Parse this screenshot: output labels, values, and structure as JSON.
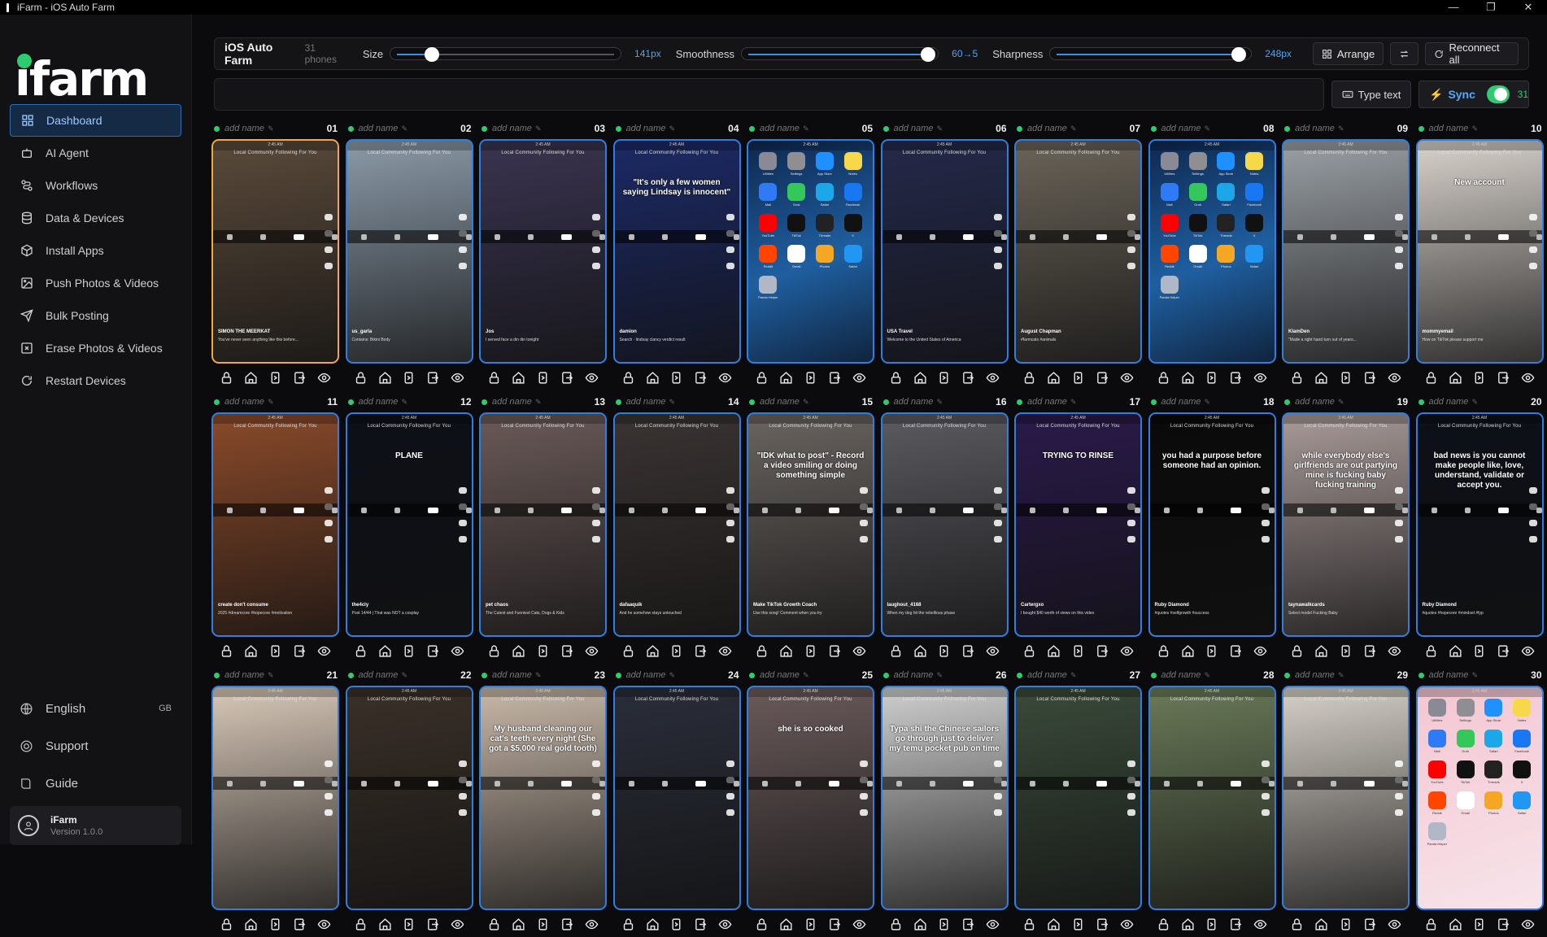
{
  "window": {
    "title": "iFarm - iOS Auto Farm",
    "controls": [
      "—",
      "❐",
      "✕"
    ]
  },
  "sidebar": {
    "logo": "ifarm",
    "items": [
      {
        "label": "Dashboard",
        "icon": "grid-icon",
        "active": true
      },
      {
        "label": "AI Agent",
        "icon": "robot-icon"
      },
      {
        "label": "Workflows",
        "icon": "workflow-icon"
      },
      {
        "label": "Data & Devices",
        "icon": "database-icon"
      },
      {
        "label": "Install Apps",
        "icon": "package-icon"
      },
      {
        "label": "Push Photos & Videos",
        "icon": "image-push-icon"
      },
      {
        "label": "Bulk Posting",
        "icon": "send-icon"
      },
      {
        "label": "Erase Photos & Videos",
        "icon": "erase-icon"
      },
      {
        "label": "Restart Devices",
        "icon": "restart-icon"
      }
    ],
    "language": {
      "label": "English",
      "code": "GB"
    },
    "support": "Support",
    "guide": "Guide",
    "user": {
      "name": "iFarm",
      "version": "Version 1.0.0"
    }
  },
  "toolbar": {
    "title": "iOS Auto Farm",
    "count": "31 phones",
    "size": {
      "label": "Size",
      "value": "141px",
      "level": 0.16
    },
    "smoothness": {
      "label": "Smoothness",
      "value": "60→5",
      "level": 0.98
    },
    "sharpness": {
      "label": "Sharpness",
      "value": "248px",
      "level": 0.97
    },
    "arrange": "Arrange",
    "reconnect": "Reconnect all"
  },
  "command": {
    "type_text": "Type text",
    "sync_label": "Sync",
    "sync_on": true,
    "sync_count": "31"
  },
  "device_name_placeholder": "add name",
  "devices": [
    {
      "num": "01",
      "screen": "tiktok",
      "selected": true,
      "user": "SIMON THE MEERKAT",
      "desc": "You've never seen anything like this before..."
    },
    {
      "num": "02",
      "screen": "tiktok",
      "user": "us_garla",
      "desc": "Contains: Bikini Body"
    },
    {
      "num": "03",
      "screen": "tiktok",
      "user": "Jos",
      "desc": "I served face a din din tonight"
    },
    {
      "num": "04",
      "screen": "tiktok",
      "caption": "\"It's only a few women saying Lindsay is innocent\"",
      "user": "damion",
      "desc": "Search · lindsay clancy verdict result"
    },
    {
      "num": "05",
      "screen": "home"
    },
    {
      "num": "06",
      "screen": "tiktok",
      "user": "USA Travel",
      "desc": "Welcome to the United States of America"
    },
    {
      "num": "07",
      "screen": "tiktok",
      "user": "August Chapman",
      "desc": "#farmcats #animals"
    },
    {
      "num": "08",
      "screen": "home"
    },
    {
      "num": "09",
      "screen": "tiktok",
      "user": "KlamDen",
      "desc": "\"Made a right hand turn out of years..."
    },
    {
      "num": "10",
      "screen": "tiktok",
      "caption": "New account",
      "user": "mommyemail",
      "desc": "How on TikTok please support me"
    },
    {
      "num": "11",
      "screen": "tiktok",
      "user": "create don't consume",
      "desc": "2025 #dreamcore #hopecore #motivation"
    },
    {
      "num": "12",
      "screen": "tiktok",
      "caption": "PLANE",
      "user": "the4cly",
      "desc": "Post 14/44 | That was NOT a cosplay"
    },
    {
      "num": "13",
      "screen": "tiktok",
      "user": "pet chaos",
      "desc": "The Cutest and Funniest Cats, Dogs & Kids"
    },
    {
      "num": "14",
      "screen": "tiktok",
      "user": "dafaaquik",
      "desc": "And he somehow stays untouched"
    },
    {
      "num": "15",
      "screen": "tiktok",
      "caption": "\"IDK what to post\" - Record a video smiling or doing something simple",
      "user": "Make TikTok Growth Coach",
      "desc": "Use this song! Comment when you try"
    },
    {
      "num": "16",
      "screen": "tiktok",
      "user": "laughout_4168",
      "desc": "When my dog hit the rebellious phase"
    },
    {
      "num": "17",
      "screen": "tiktok",
      "caption": "TRYING TO RINSE",
      "user": "Cartergxo",
      "desc": "I bought $40 worth of views on this video"
    },
    {
      "num": "18",
      "screen": "tiktok",
      "caption": "you had a purpose before someone had an opinion.",
      "user": "Ruby Diamond",
      "desc": "#quotes #selfgrowth #success"
    },
    {
      "num": "19",
      "screen": "tiktok",
      "caption": "while everybody else's girlfriends are out partying mine is fucking baby fucking training",
      "user": "taynawalkcards",
      "desc": "Select model Fucking Baby"
    },
    {
      "num": "20",
      "screen": "tiktok",
      "caption": "bad news is you cannot make people like, love, understand, validate or accept you.",
      "user": "Ruby Diamond",
      "desc": "#quotes #hopecore #mindset #fyp"
    },
    {
      "num": "21",
      "screen": "tiktok",
      "user": "",
      "desc": ""
    },
    {
      "num": "22",
      "screen": "tiktok",
      "user": "",
      "desc": ""
    },
    {
      "num": "23",
      "screen": "tiktok",
      "caption": "My husband cleaning our cat's teeth every night (She got a $5,000 real gold tooth)",
      "user": "",
      "desc": ""
    },
    {
      "num": "24",
      "screen": "tiktok",
      "user": "",
      "desc": ""
    },
    {
      "num": "25",
      "screen": "tiktok",
      "caption": "she is so cooked",
      "user": "",
      "desc": ""
    },
    {
      "num": "26",
      "screen": "tiktok",
      "caption": "Typa shi the Chinese sailors go through just to deliver my temu pocket pub on time",
      "user": "",
      "desc": ""
    },
    {
      "num": "27",
      "screen": "tiktok",
      "user": "",
      "desc": ""
    },
    {
      "num": "28",
      "screen": "tiktok",
      "user": "",
      "desc": ""
    },
    {
      "num": "29",
      "screen": "tiktok",
      "user": "",
      "desc": ""
    },
    {
      "num": "30",
      "screen": "home_light"
    }
  ],
  "tiktok_ui": {
    "status": "2:45 AM",
    "tabs": "Local   Community   Following   For You"
  },
  "home_apps": [
    "Utilities",
    "Settings",
    "App Store",
    "Notes",
    "Mail",
    "Grok",
    "Safari",
    "Facebook",
    "YouTube",
    "TikTok",
    "Threads",
    "X",
    "Reddit",
    "Gmail",
    "Photos",
    "Safari",
    "Panda Helper"
  ],
  "home_colors": [
    "#8a8a96",
    "#8e8e93",
    "#1e90ff",
    "#f7d84a",
    "#2f7bf5",
    "#34c759",
    "#1ba7e8",
    "#1877f2",
    "#ff0000",
    "#111111",
    "#222222",
    "#111111",
    "#ff4500",
    "#ffffff",
    "#f5a623",
    "#2196f3",
    "#b0b8c8"
  ],
  "screen_palettes": [
    "#5a4a3a",
    "#8b9aa8",
    "#3a3450",
    "#1c2a66",
    "#1a3d66",
    "#24294a",
    "#6a6358",
    "#1a3d66",
    "#9aa0a6",
    "#d8d2cc",
    "#8a4a2a",
    "#0d1018",
    "#6a5a58",
    "#3a3432",
    "#6a6460",
    "#5a5a60",
    "#2a1a4a",
    "#0a0a0a",
    "#a89a98",
    "#0c1018",
    "#d8c8b8",
    "#3a3028",
    "#c8b8a8",
    "#2a2e3a",
    "#6a5a5a",
    "#cfcfcf",
    "#3a4a3a",
    "#6a7a58",
    "#d6d0c8",
    "#f0c8d0"
  ],
  "accents": {
    "primary": "#2f7fe0",
    "selected": "#f4a640",
    "online": "#2ecc71"
  }
}
